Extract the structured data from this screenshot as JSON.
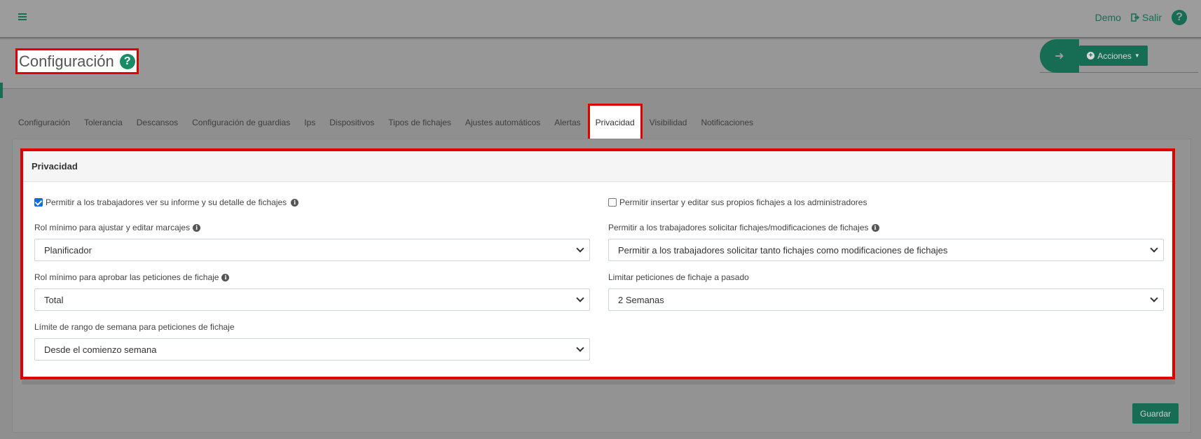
{
  "topbar": {
    "menu_icon": "hamburger-icon",
    "user": "Demo",
    "logout": "Salir",
    "help_icon": "question-circle-icon"
  },
  "header": {
    "title": "Configuración",
    "help_icon": "question-circle-icon",
    "actions_label": "Acciones",
    "arrow_icon": "arrow-right-icon"
  },
  "tabs": [
    {
      "label": "Configuración"
    },
    {
      "label": "Tolerancia"
    },
    {
      "label": "Descansos"
    },
    {
      "label": "Configuración de guardias"
    },
    {
      "label": "Ips"
    },
    {
      "label": "Dispositivos"
    },
    {
      "label": "Tipos de fichajes"
    },
    {
      "label": "Ajustes automáticos"
    },
    {
      "label": "Alertas"
    },
    {
      "label": "Privacidad",
      "active": true
    },
    {
      "label": "Visibilidad"
    },
    {
      "label": "Notificaciones"
    }
  ],
  "panel": {
    "title": "Privacidad",
    "allow_view_report": {
      "label": "Permitir a los trabajadores ver su informe y su detalle de fichajes",
      "checked": true
    },
    "allow_admin_edit": {
      "label": "Permitir insertar y editar sus propios fichajes a los administradores",
      "checked": false
    },
    "min_role_edit": {
      "label": "Rol mínimo para ajustar y editar marcajes",
      "value": "Planificador"
    },
    "allow_request": {
      "label": "Permitir a los trabajadores solicitar fichajes/modificaciones de fichajes",
      "value": "Permitir a los trabajadores solicitar tanto fichajes como modificaciones de fichajes"
    },
    "min_role_approve": {
      "label": "Rol mínimo para aprobar las peticiones de fichaje",
      "value": "Total"
    },
    "limit_past": {
      "label": "Limitar peticiones de fichaje a pasado",
      "value": "2 Semanas"
    },
    "week_range": {
      "label": "Límite de rango de semana para peticiones de fichaje",
      "value": "Desde el comienzo semana"
    }
  },
  "footer": {
    "save_label": "Guardar"
  },
  "colors": {
    "brand": "#176d54",
    "highlight": "#e00000"
  }
}
